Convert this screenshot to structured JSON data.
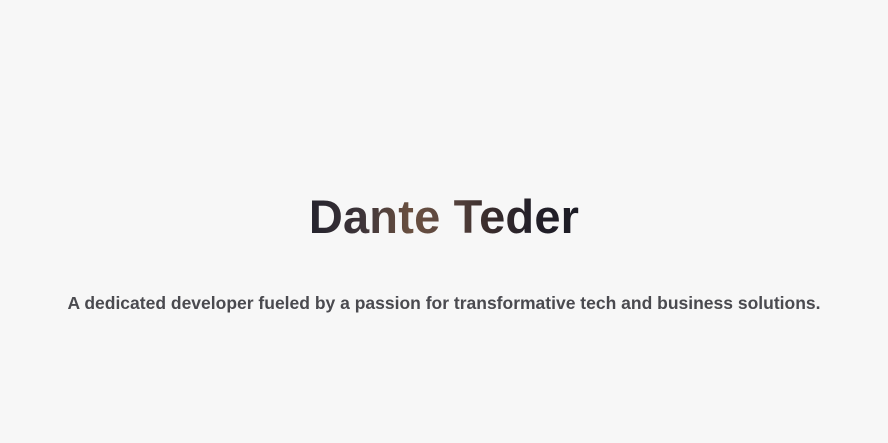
{
  "hero": {
    "name": "Dante Teder",
    "tagline": "A dedicated developer fueled by a passion for transformative tech and business solutions."
  },
  "colors": {
    "background": "#f7f7f7",
    "name_gradient": [
      "#23222c",
      "#6a5040",
      "#1c1c25"
    ],
    "tagline": "#4a4a4f"
  }
}
